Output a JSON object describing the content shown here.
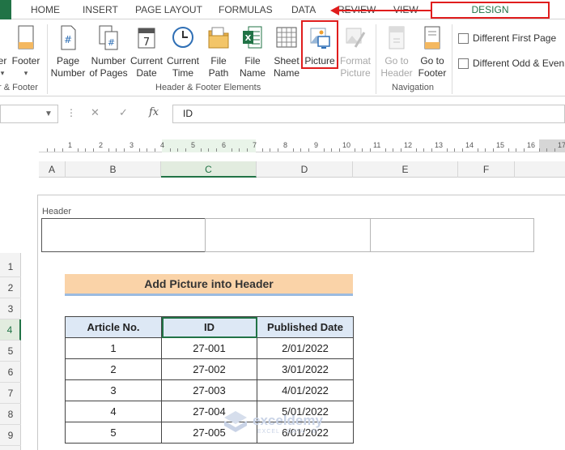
{
  "tabs": {
    "home": "HOME",
    "insert": "INSERT",
    "page_layout": "PAGE LAYOUT",
    "formulas": "FORMULAS",
    "data": "DATA",
    "review": "REVIEW",
    "view": "VIEW",
    "design": "DESIGN"
  },
  "ribbon": {
    "header_footer_group": {
      "header_label": "er",
      "footer_label": "Footer",
      "group_label": "r & Footer"
    },
    "elements_group": {
      "page_number": [
        "Page",
        "Number"
      ],
      "number_of_pages": [
        "Number",
        "of Pages"
      ],
      "current_date": [
        "Current",
        "Date"
      ],
      "current_time": [
        "Current",
        "Time"
      ],
      "file_path": [
        "File",
        "Path"
      ],
      "file_name": [
        "File",
        "Name"
      ],
      "sheet_name": [
        "Sheet",
        "Name"
      ],
      "picture": [
        "Picture"
      ],
      "format_picture": [
        "Format",
        "Picture"
      ],
      "group_label": "Header & Footer Elements"
    },
    "navigation_group": {
      "go_to_header": [
        "Go to",
        "Header"
      ],
      "go_to_footer": [
        "Go to",
        "Footer"
      ],
      "group_label": "Navigation"
    },
    "options": {
      "different_first_page": "Different First Page",
      "different_odd_even": "Different Odd & Even"
    }
  },
  "formula_bar": {
    "value": "ID",
    "fx": "fx"
  },
  "ruler": [
    "1",
    "2",
    "3",
    "4",
    "5",
    "6",
    "7",
    "8",
    "9",
    "10",
    "11",
    "12",
    "13",
    "14",
    "15",
    "16",
    "17"
  ],
  "columns": [
    "A",
    "B",
    "C",
    "D",
    "E",
    "F"
  ],
  "rows": [
    "1",
    "2",
    "3",
    "4",
    "5",
    "6",
    "7",
    "8",
    "9"
  ],
  "page": {
    "header_label": "Header"
  },
  "sheet": {
    "title": "Add Picture into Header",
    "headers": [
      "Article No.",
      "ID",
      "Published Date"
    ],
    "rows": [
      [
        "1",
        "27-001",
        "2/01/2022"
      ],
      [
        "2",
        "27-002",
        "3/01/2022"
      ],
      [
        "3",
        "27-003",
        "4/01/2022"
      ],
      [
        "4",
        "27-004",
        "5/01/2022"
      ],
      [
        "5",
        "27-005",
        "6/01/2022"
      ]
    ]
  },
  "watermark": {
    "name": "exceldemy",
    "tagline": "EXCEL · DATA · BI"
  },
  "colors": {
    "excel_green": "#217346",
    "highlight_red": "#e01d1d",
    "title_fill": "#fad3a8",
    "header_fill": "#dde8f5"
  }
}
